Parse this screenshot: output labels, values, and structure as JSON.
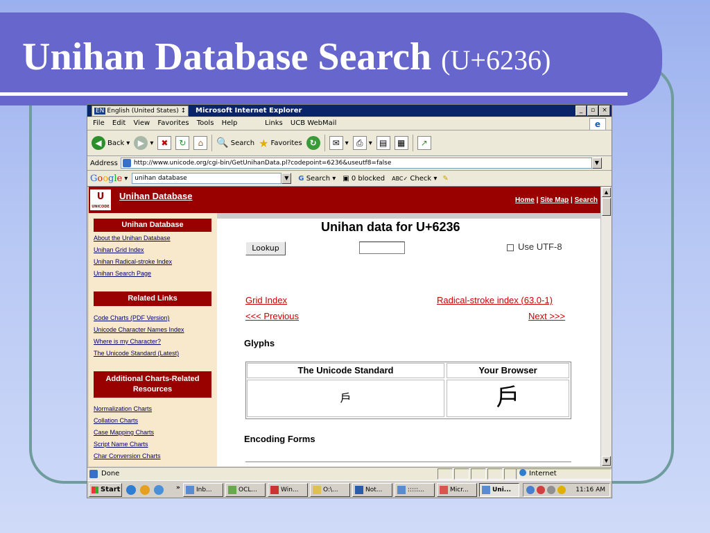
{
  "slide": {
    "title": "Unihan Database Search",
    "subtitle": "(U+6236)"
  },
  "window": {
    "language": "English (United States)",
    "language_code": "EN",
    "title": "Microsoft Internet Explorer",
    "controls": [
      "_",
      "▫",
      "×"
    ]
  },
  "menu": {
    "items": [
      "File",
      "Edit",
      "View",
      "Favorites",
      "Tools",
      "Help"
    ],
    "links_label": "Links",
    "link_item": "UCB WebMail"
  },
  "toolbar": {
    "back": "Back",
    "search": "Search",
    "favorites": "Favorites"
  },
  "address": {
    "label": "Address",
    "url": "http://www.unicode.org/cgi-bin/GetUnihanData.pl?codepoint=6236&useutf8=false"
  },
  "google": {
    "query": "unihan database",
    "search_label": "Search",
    "blocked_label": "0 blocked",
    "check_label": "Check"
  },
  "site": {
    "logo_text": "U",
    "logo_small": "UNICODE",
    "name": "Unihan Database",
    "nav": [
      "Home",
      "Site Map",
      "Search"
    ]
  },
  "sidebar": {
    "section1": {
      "heading": "Unihan Database",
      "links": [
        "About the Unihan Database",
        "Unihan Grid Index",
        "Unihan Radical-stroke Index",
        "Unihan Search Page"
      ]
    },
    "section2": {
      "heading": "Related Links",
      "links": [
        "Code Charts (PDF Version)",
        "Unicode Character Names Index",
        "Where is my Character?",
        "The Unicode Standard (Latest)"
      ]
    },
    "section3": {
      "heading_line1": "Additional Charts-Related",
      "heading_line2": "Resources",
      "links": [
        "Normalization Charts",
        "Collation Charts",
        "Case Mapping Charts",
        "Script Name Charts",
        "Char Conversion Charts"
      ]
    }
  },
  "main": {
    "heading": "Unihan data for U+6236",
    "lookup_button": "Lookup",
    "codepoint_value": "",
    "utf8_label": "Use UTF-8",
    "grid_index": "Grid Index",
    "radical_index": "Radical-stroke index (63.0-1)",
    "previous": "<<< Previous",
    "next": "Next >>>",
    "glyphs_heading": "Glyphs",
    "col_standard": "The Unicode Standard",
    "col_browser": "Your Browser",
    "glyph_standard": "戶",
    "glyph_browser": "戶",
    "encoding_heading": "Encoding Forms"
  },
  "status": {
    "text": "Done",
    "zone": "Internet"
  },
  "taskbar": {
    "start": "Start",
    "overflow": "»",
    "tasks": [
      "Inb...",
      "OCL...",
      "Win...",
      "O:\\...",
      "Not...",
      ":::::...",
      "Micr...",
      "Uni..."
    ],
    "time": "11:16 AM"
  }
}
